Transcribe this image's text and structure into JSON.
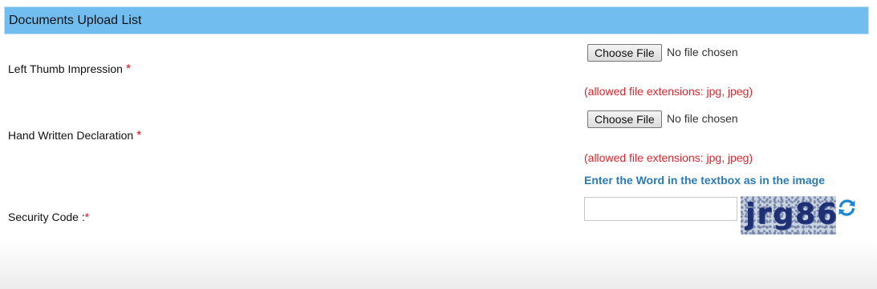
{
  "header": {
    "title": "Documents Upload List"
  },
  "fields": {
    "thumb": {
      "label": "Left Thumb Impression",
      "required": "*",
      "button": "Choose File",
      "status": "No file chosen",
      "allowed": "(allowed file extensions: jpg, jpeg)"
    },
    "declaration": {
      "label": "Hand Written Declaration",
      "required": "*",
      "button": "Choose File",
      "status": "No file chosen",
      "allowed": "(allowed file extensions: jpg, jpeg)"
    }
  },
  "security": {
    "label": "Security Code :",
    "required": "*",
    "hint": "Enter the Word in the textbox as in the image",
    "input_value": "",
    "captcha_text": "jrg86",
    "refresh_icon": "refresh-icon"
  },
  "colors": {
    "header_bg": "#72bdf0",
    "required": "#e01020",
    "allowed_text": "#e8222a",
    "hint_text": "#2a7ab6",
    "captcha_text": "#1e2f73"
  }
}
